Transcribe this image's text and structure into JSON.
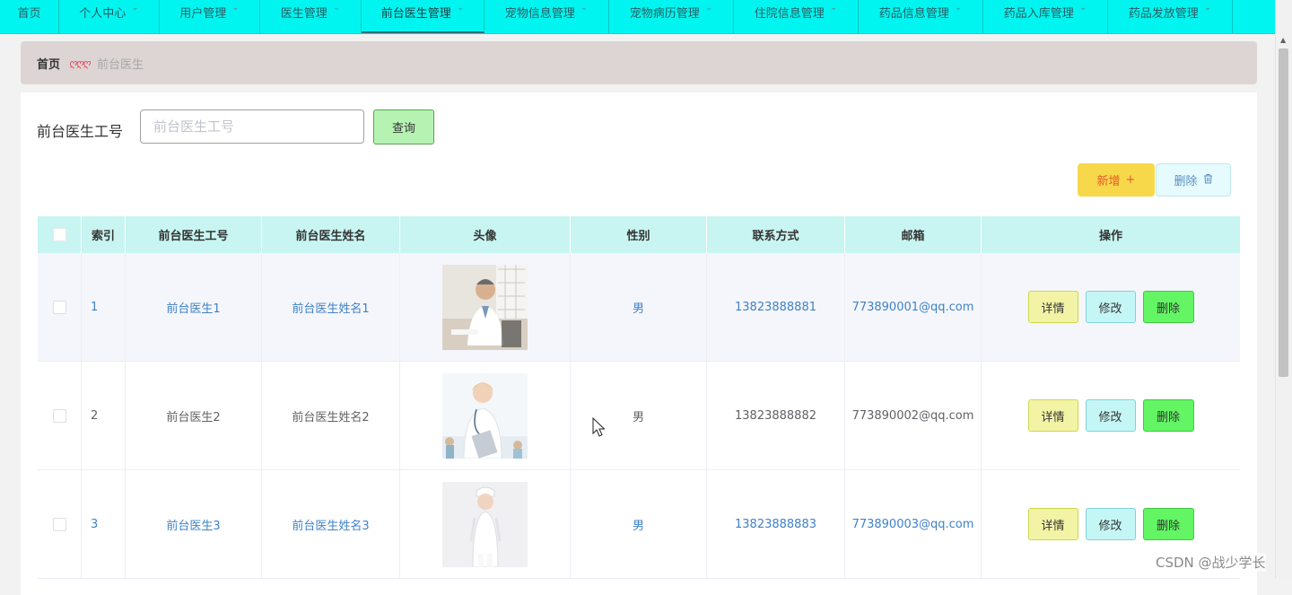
{
  "nav": {
    "items": [
      {
        "label": "首页",
        "chevron": false
      },
      {
        "label": "个人中心",
        "chevron": true
      },
      {
        "label": "用户管理",
        "chevron": true
      },
      {
        "label": "医生管理",
        "chevron": true
      },
      {
        "label": "前台医生管理",
        "chevron": true,
        "active": true
      },
      {
        "label": "宠物信息管理",
        "chevron": true
      },
      {
        "label": "宠物病历管理",
        "chevron": true
      },
      {
        "label": "住院信息管理",
        "chevron": true
      },
      {
        "label": "药品信息管理",
        "chevron": true
      },
      {
        "label": "药品入库管理",
        "chevron": true
      },
      {
        "label": "药品发放管理",
        "chevron": true
      }
    ]
  },
  "breadcrumb": {
    "home": "首页",
    "separator": "ღღღ",
    "current": "前台医生"
  },
  "search": {
    "label": "前台医生工号",
    "placeholder": "前台医生工号",
    "value": "",
    "button": "查询"
  },
  "actions": {
    "add": "新增",
    "add_icon": "+",
    "delete": "删除",
    "delete_icon": "trash-icon"
  },
  "table": {
    "headers": [
      "索引",
      "前台医生工号",
      "前台医生姓名",
      "头像",
      "性别",
      "联系方式",
      "邮箱",
      "操作"
    ],
    "rows": [
      {
        "index": "1",
        "id": "前台医生1",
        "name": "前台医生姓名1",
        "gender": "男",
        "phone": "13823888881",
        "email": "773890001@qq.com"
      },
      {
        "index": "2",
        "id": "前台医生2",
        "name": "前台医生姓名2",
        "gender": "男",
        "phone": "13823888882",
        "email": "773890002@qq.com"
      },
      {
        "index": "3",
        "id": "前台医生3",
        "name": "前台医生姓名3",
        "gender": "男",
        "phone": "13823888883",
        "email": "773890003@qq.com"
      }
    ],
    "row_actions": {
      "detail": "详情",
      "edit": "修改",
      "delete": "删除"
    }
  },
  "watermark": "CSDN @战少学长",
  "colors": {
    "nav_bg": "#00f5f0",
    "header_bg": "#c8f5f2",
    "link": "#3f82c7",
    "add_btn": "#f7d84a",
    "delete_btn_row": "#63f563"
  }
}
